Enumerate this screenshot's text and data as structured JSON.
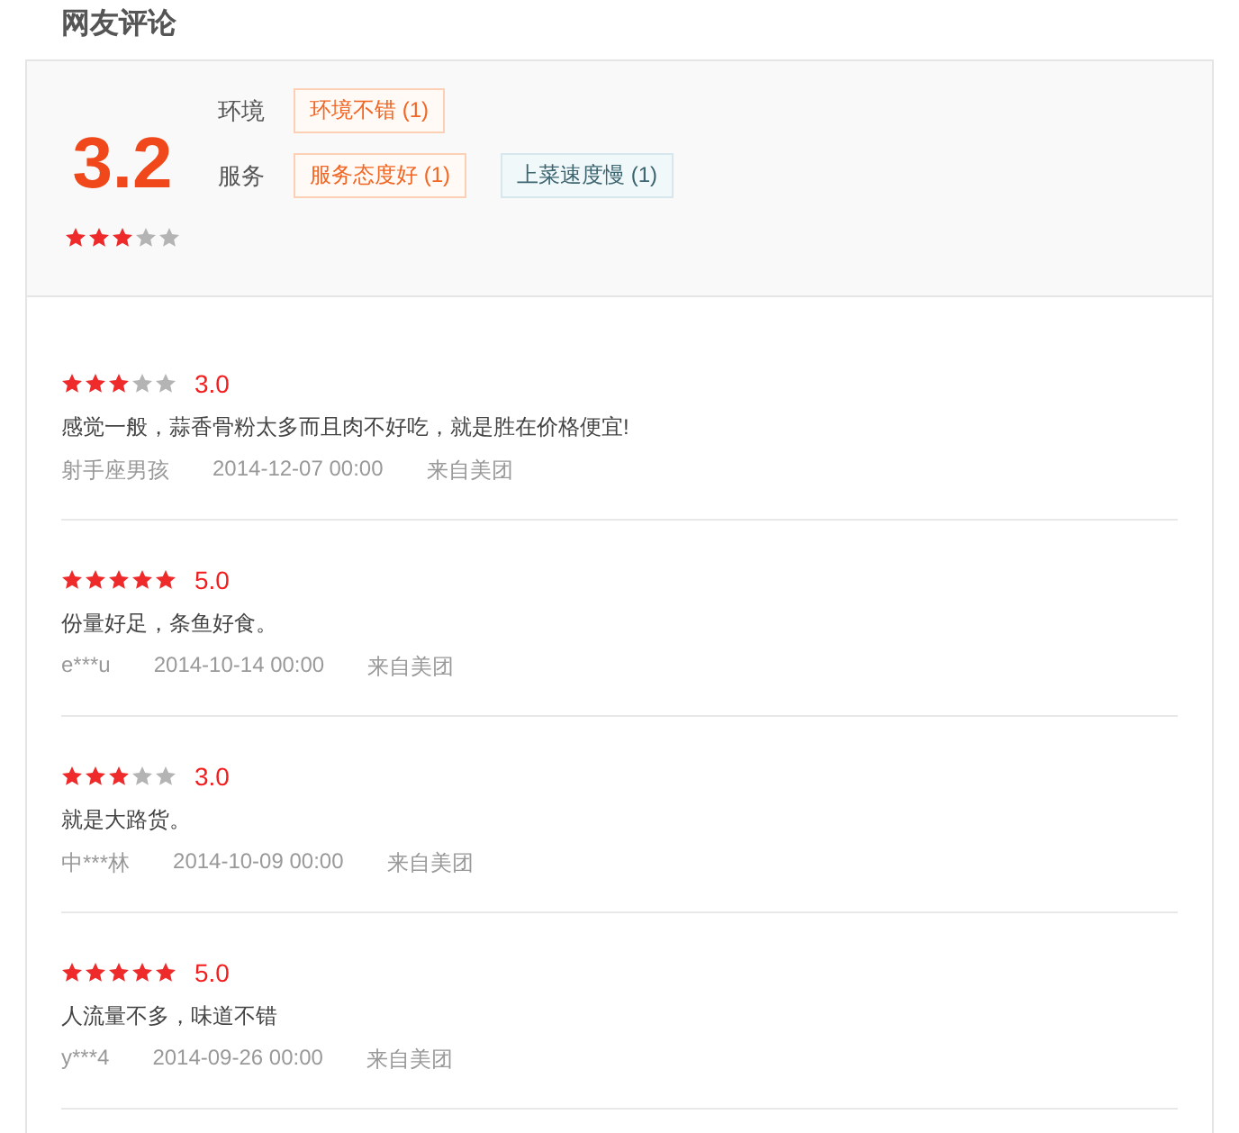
{
  "section_title": "网友评论",
  "summary": {
    "score": "3.2",
    "stars": 3,
    "categories": [
      {
        "label": "环境",
        "tags": [
          {
            "text": "环境不错 (1)",
            "kind": "positive"
          }
        ]
      },
      {
        "label": "服务",
        "tags": [
          {
            "text": "服务态度好 (1)",
            "kind": "positive"
          },
          {
            "text": "上菜速度慢 (1)",
            "kind": "negative"
          }
        ]
      }
    ]
  },
  "reviews": [
    {
      "stars": 3,
      "score": "3.0",
      "text": "感觉一般，蒜香骨粉太多而且肉不好吃，就是胜在价格便宜!",
      "user": "射手座男孩",
      "time": "2014-12-07 00:00",
      "source": "来自美团"
    },
    {
      "stars": 5,
      "score": "5.0",
      "text": "份量好足，条鱼好食。",
      "user": "e***u",
      "time": "2014-10-14 00:00",
      "source": "来自美团"
    },
    {
      "stars": 3,
      "score": "3.0",
      "text": "就是大路货。",
      "user": "中***林",
      "time": "2014-10-09 00:00",
      "source": "来自美团"
    },
    {
      "stars": 5,
      "score": "5.0",
      "text": "人流量不多，味道不错",
      "user": "y***4",
      "time": "2014-09-26 00:00",
      "source": "来自美团"
    }
  ]
}
